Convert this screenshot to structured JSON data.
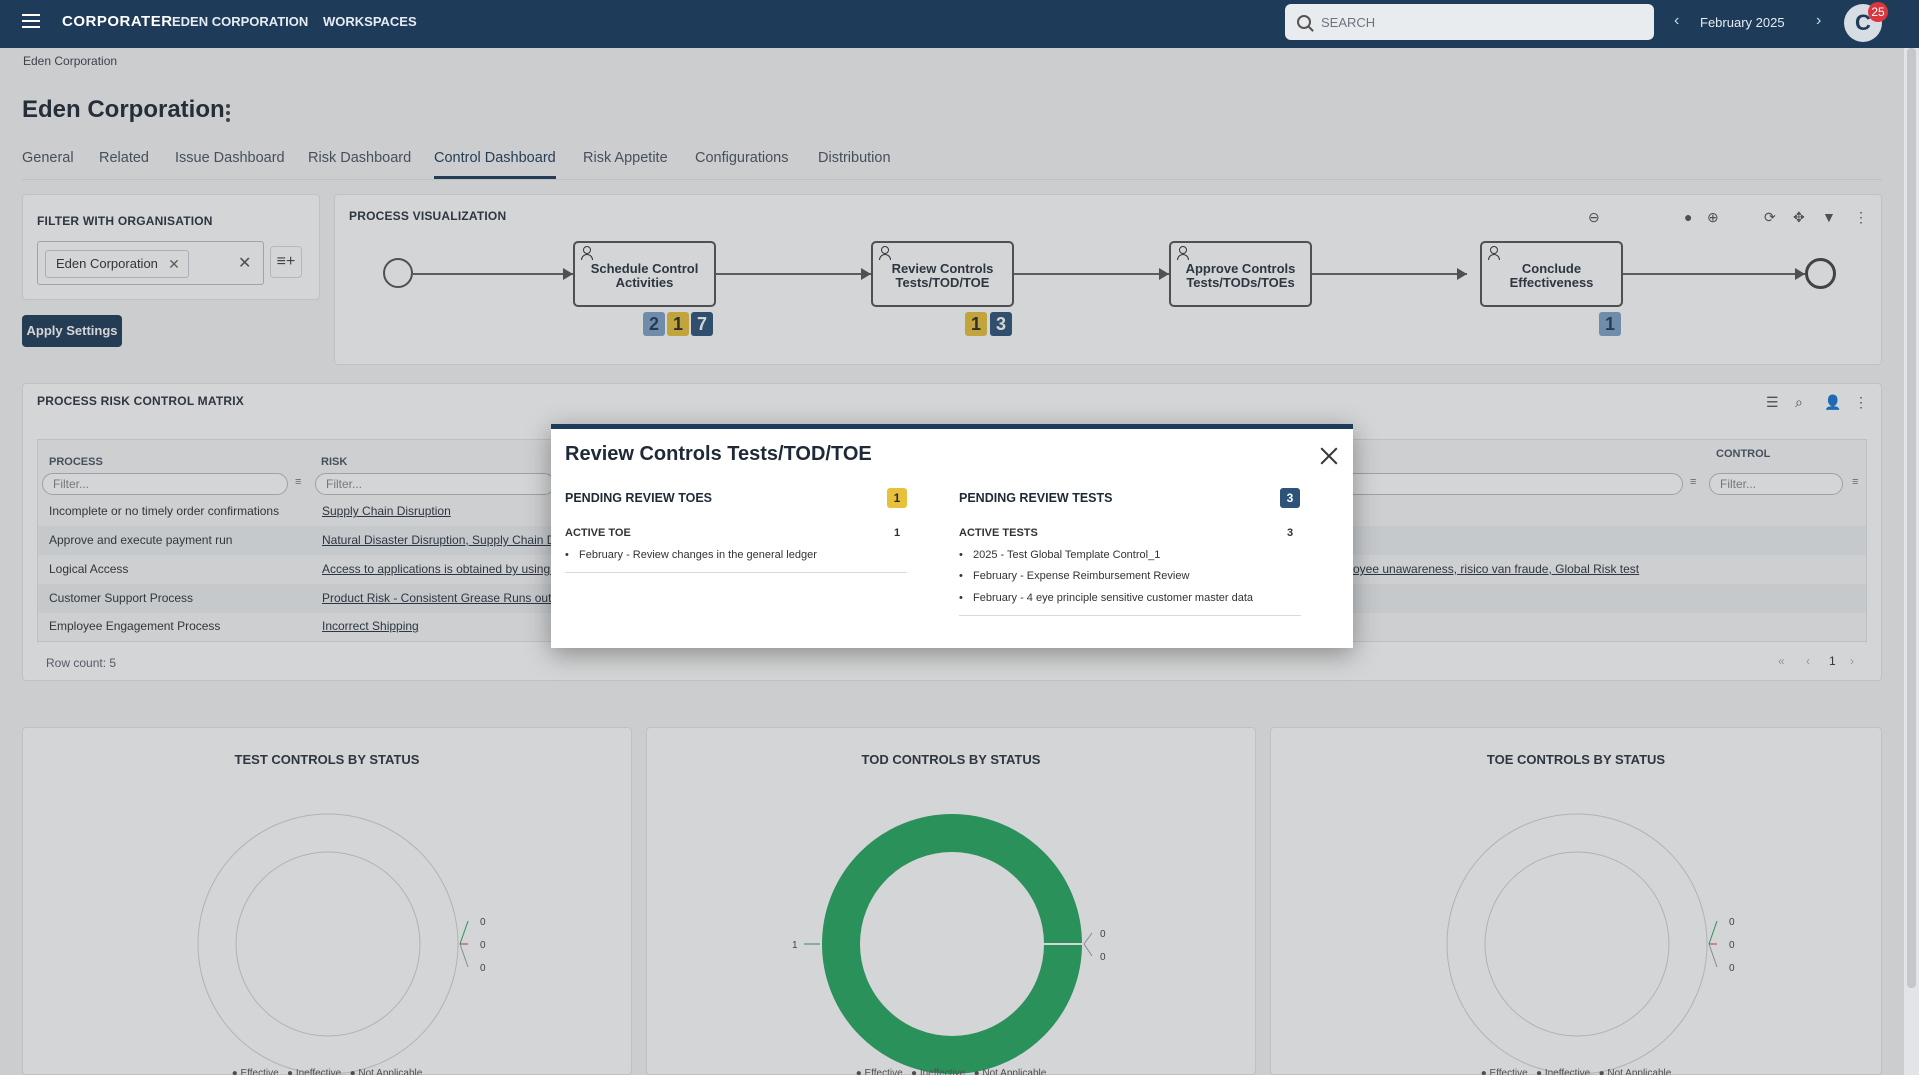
{
  "topbar": {
    "logo": "CORPORATER",
    "org_link": "EDEN CORPORATION",
    "workspaces_link": "WORKSPACES",
    "search_placeholder": "SEARCH",
    "period": "February 2025",
    "avatar_letter": "C",
    "notification_count": "25"
  },
  "breadcrumb": "Eden Corporation",
  "page_title": "Eden Corporation",
  "tabs": [
    "General",
    "Related",
    "Issue Dashboard",
    "Risk Dashboard",
    "Control Dashboard",
    "Risk Appetite",
    "Configurations",
    "Distribution"
  ],
  "active_tab": "Control Dashboard",
  "filter_panel": {
    "title": "FILTER WITH ORGANISATION",
    "selected_chip": "Eden Corporation",
    "apply_label": "Apply Settings"
  },
  "process_visualization": {
    "title": "PROCESS VISUALIZATION",
    "nodes": [
      {
        "label": "Schedule Control Activities",
        "badges": [
          {
            "value": "2",
            "color": "light"
          },
          {
            "value": "1",
            "color": "yellow"
          },
          {
            "value": "7",
            "color": "dark"
          }
        ]
      },
      {
        "label": "Review Controls Tests/TOD/TOE",
        "badges": [
          {
            "value": "1",
            "color": "yellow"
          },
          {
            "value": "3",
            "color": "dark"
          }
        ]
      },
      {
        "label": "Approve Controls Tests/TODs/TOEs",
        "badges": []
      },
      {
        "label": "Conclude Effectiveness",
        "badges": [
          {
            "value": "1",
            "color": "light"
          }
        ]
      }
    ]
  },
  "matrix": {
    "title": "PROCESS RISK CONTROL MATRIX",
    "columns": [
      "PROCESS",
      "RISK",
      "CONTROL"
    ],
    "filter_placeholder": "Filter...",
    "rows": [
      {
        "process": "Incomplete or no timely order confirmations",
        "risk": "Supply Chain Disruption",
        "control": ""
      },
      {
        "process": "Approve and execute payment run",
        "risk": "Natural Disaster Disruption, Supply Chain Di",
        "control": ""
      },
      {
        "process": "Logical Access",
        "risk": "Access to applications is obtained by using o",
        "control": "oyee unawareness, risico van fraude, Global Risk test"
      },
      {
        "process": "Customer Support Process",
        "risk": "Product Risk - Consistent Grease Runs out , I",
        "control": ""
      },
      {
        "process": "Employee Engagement Process",
        "risk": "Incorrect Shipping",
        "control": ""
      }
    ],
    "row_count": "Row count: 5",
    "page": "1"
  },
  "charts": [
    {
      "title": "TEST CONTROLS BY STATUS",
      "labels": [
        "0",
        "0",
        "0"
      ]
    },
    {
      "title": "TOD CONTROLS BY STATUS",
      "labels": [
        "1",
        "0",
        "0"
      ]
    },
    {
      "title": "TOE CONTROLS BY STATUS",
      "labels": [
        "0",
        "0",
        "0"
      ]
    }
  ],
  "chart_data": [
    {
      "type": "pie",
      "title": "TEST CONTROLS BY STATUS",
      "categories": [
        "Effective",
        "Ineffective",
        "Not Applicable"
      ],
      "values": [
        0,
        0,
        0
      ]
    },
    {
      "type": "pie",
      "title": "TOD CONTROLS BY STATUS",
      "categories": [
        "Effective",
        "Ineffective",
        "Not Applicable"
      ],
      "values": [
        1,
        0,
        0
      ]
    },
    {
      "type": "pie",
      "title": "TOE CONTROLS BY STATUS",
      "categories": [
        "Effective",
        "Ineffective",
        "Not Applicable"
      ],
      "values": [
        0,
        0,
        0
      ]
    }
  ],
  "colors": {
    "effective": "#27a862",
    "ineffective": "#d9363e",
    "not_applicable": "#9aa0a6",
    "brand": "#1f3b5a"
  },
  "modal": {
    "title": "Review Controls Tests/TOD/TOE",
    "left": {
      "title": "PENDING REVIEW TOES",
      "badge": "1",
      "sub_title": "ACTIVE TOE",
      "sub_count": "1",
      "items": [
        "February - Review changes in the general ledger"
      ]
    },
    "right": {
      "title": "PENDING REVIEW TESTS",
      "badge": "3",
      "sub_title": "ACTIVE TESTS",
      "sub_count": "3",
      "items": [
        "2025 - Test Global Template Control_1",
        "February - Expense Reimbursement Review",
        "February - 4 eye principle sensitive customer master data"
      ]
    }
  }
}
